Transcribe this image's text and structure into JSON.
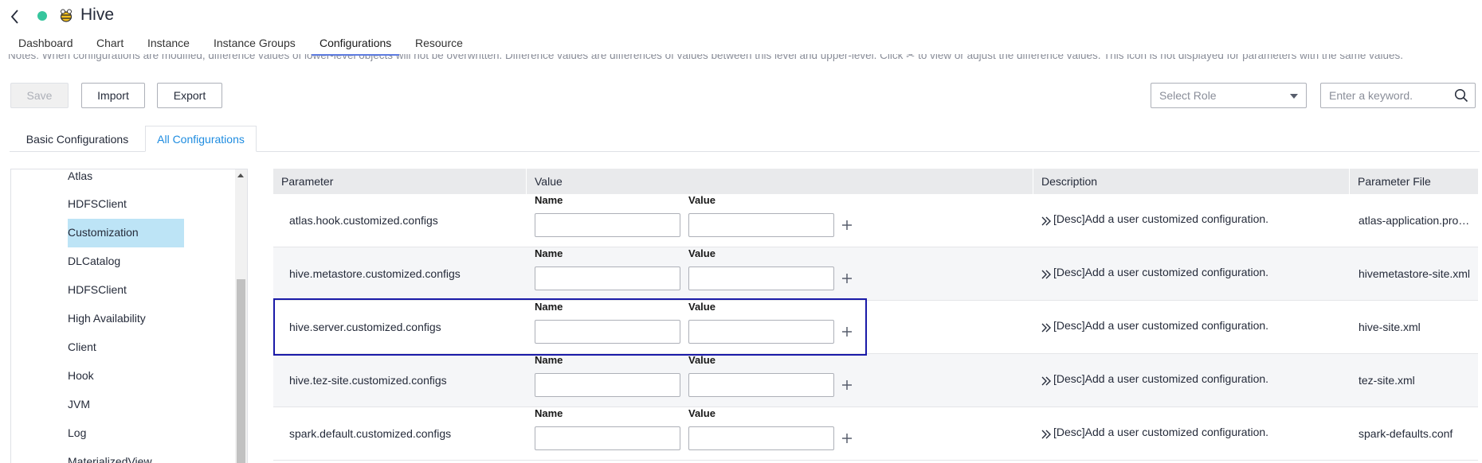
{
  "header": {
    "title": "Hive",
    "status_color": "#36c59d",
    "icons": [
      "back-icon",
      "hive-bee-icon"
    ]
  },
  "tabs": [
    {
      "label": "Dashboard",
      "active": false
    },
    {
      "label": "Chart",
      "active": false
    },
    {
      "label": "Instance",
      "active": false
    },
    {
      "label": "Instance Groups",
      "active": false
    },
    {
      "label": "Configurations",
      "active": true
    },
    {
      "label": "Resource",
      "active": false
    }
  ],
  "notes": "Notes: When configurations are modified, difference values of lower-level objects will not be overwritten. Difference values are differences of values between this level and upper-level. Click ✂ to view or adjust the difference values. This icon is not displayed for parameters with the same values.",
  "toolbar": {
    "save_label": "Save",
    "import_label": "Import",
    "export_label": "Export",
    "role_placeholder": "Select Role",
    "search_placeholder": "Enter a keyword."
  },
  "subtabs": [
    {
      "label": "Basic Configurations",
      "active": false
    },
    {
      "label": "All Configurations",
      "active": true
    }
  ],
  "tree": {
    "items": [
      "Atlas",
      "HDFSClient",
      "Customization",
      "DLCatalog",
      "HDFSClient",
      "High Availability",
      "Client",
      "Hook",
      "JVM",
      "Log",
      "MaterializedView"
    ],
    "selected": "Customization"
  },
  "table": {
    "headers": {
      "parameter": "Parameter",
      "value": "Value",
      "description": "Description",
      "file": "Parameter File"
    },
    "kv_labels": {
      "name": "Name",
      "value": "Value"
    },
    "rows": [
      {
        "parameter": "atlas.hook.customized.configs",
        "description": "[Desc]Add a user customized configuration.",
        "file": "atlas-application.properties"
      },
      {
        "parameter": "hive.metastore.customized.configs",
        "description": "[Desc]Add a user customized configuration.",
        "file": "hivemetastore-site.xml"
      },
      {
        "parameter": "hive.server.customized.configs",
        "description": "[Desc]Add a user customized configuration.",
        "file": "hive-site.xml"
      },
      {
        "parameter": "hive.tez-site.customized.configs",
        "description": "[Desc]Add a user customized configuration.",
        "file": "tez-site.xml"
      },
      {
        "parameter": "spark.default.customized.configs",
        "description": "[Desc]Add a user customized configuration.",
        "file": "spark-defaults.conf"
      }
    ]
  },
  "colors": {
    "accent": "#5e7ce0",
    "active_tab_text": "#1e8ce0",
    "highlight_border": "#1a1aa8",
    "selected_tree_bg": "#bde4f6"
  }
}
